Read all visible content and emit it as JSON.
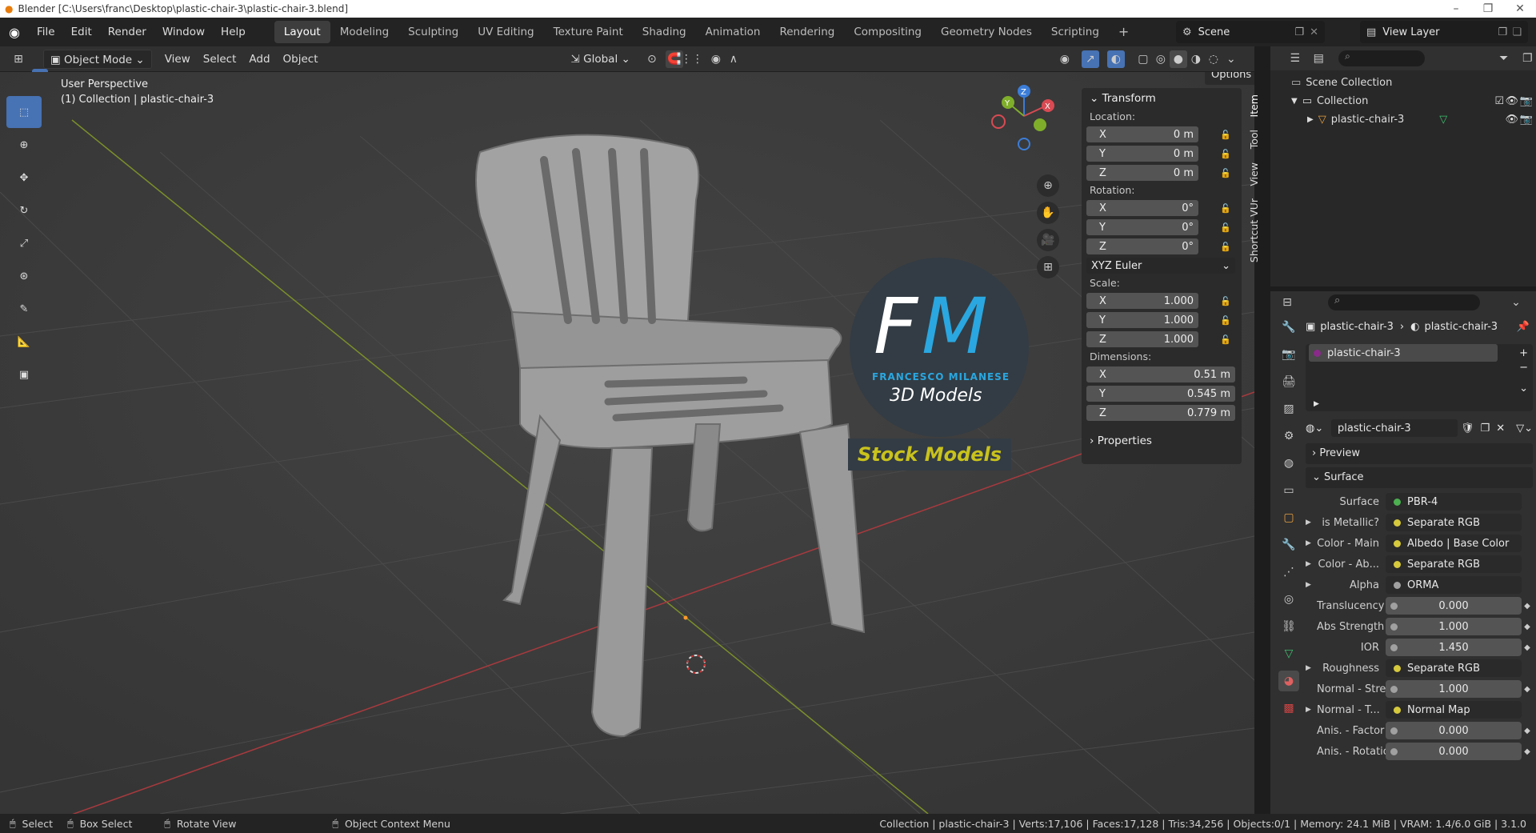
{
  "window": {
    "title": "Blender [C:\\Users\\franc\\Desktop\\plastic-chair-3\\plastic-chair-3.blend]",
    "controls": [
      "–",
      "❐",
      "✕"
    ]
  },
  "menu": {
    "items": [
      "File",
      "Edit",
      "Render",
      "Window",
      "Help"
    ]
  },
  "workspaces": {
    "tabs": [
      "Layout",
      "Modeling",
      "Sculpting",
      "UV Editing",
      "Texture Paint",
      "Shading",
      "Animation",
      "Rendering",
      "Compositing",
      "Geometry Nodes",
      "Scripting"
    ],
    "add": "+"
  },
  "scene": {
    "name": "Scene",
    "view_layer": "View Layer"
  },
  "header": {
    "mode": "Object Mode",
    "view": "View",
    "select": "Select",
    "add": "Add",
    "object": "Object",
    "transform_orientation": "Global",
    "options": "Options"
  },
  "viewport": {
    "perspective": "User Perspective",
    "collection_info": "(1) Collection | plastic-chair-3",
    "gizmo": {
      "x": "X",
      "y": "Y",
      "z": "Z"
    }
  },
  "watermark": {
    "letters_f": "F",
    "letters_m": "M",
    "brand": "FRANCESCO MILANESE",
    "tagline": "3D Models",
    "banner": "Stock Models"
  },
  "npanel": {
    "transform_title": "Transform",
    "location_label": "Location:",
    "location": [
      {
        "axis": "X",
        "value": "0 m"
      },
      {
        "axis": "Y",
        "value": "0 m"
      },
      {
        "axis": "Z",
        "value": "0 m"
      }
    ],
    "rotation_label": "Rotation:",
    "rotation": [
      {
        "axis": "X",
        "value": "0°"
      },
      {
        "axis": "Y",
        "value": "0°"
      },
      {
        "axis": "Z",
        "value": "0°"
      }
    ],
    "rotation_mode": "XYZ Euler",
    "scale_label": "Scale:",
    "scale": [
      {
        "axis": "X",
        "value": "1.000"
      },
      {
        "axis": "Y",
        "value": "1.000"
      },
      {
        "axis": "Z",
        "value": "1.000"
      }
    ],
    "dimensions_label": "Dimensions:",
    "dimensions": [
      {
        "axis": "X",
        "value": "0.51 m"
      },
      {
        "axis": "Y",
        "value": "0.545 m"
      },
      {
        "axis": "Z",
        "value": "0.779 m"
      }
    ],
    "properties_title": "Properties",
    "tabs": [
      "Item",
      "Tool",
      "View",
      "Shortcut VUr"
    ]
  },
  "outliner": {
    "scene_collection": "Scene Collection",
    "collection": "Collection",
    "object": "plastic-chair-3"
  },
  "properties": {
    "breadcrumb_obj": "plastic-chair-3",
    "breadcrumb_mat": "plastic-chair-3",
    "material_slot": "plastic-chair-3",
    "material_name": "plastic-chair-3",
    "preview": "Preview",
    "surface_section": "Surface",
    "rows": [
      {
        "label": "Surface",
        "value": "PBR-4",
        "dot": "#4caf50",
        "kind": "link",
        "expand": false
      },
      {
        "label": "is Metallic?",
        "value": "Separate RGB",
        "dot": "#d6c93c",
        "kind": "link",
        "expand": true
      },
      {
        "label": "Color - Main",
        "value": "Albedo | Base Color",
        "dot": "#d6c93c",
        "kind": "link",
        "expand": true
      },
      {
        "label": "Color - Ab...",
        "value": "Separate RGB",
        "dot": "#d6c93c",
        "kind": "link",
        "expand": true
      },
      {
        "label": "Alpha",
        "value": "ORMA",
        "dot": "#a0a0a0",
        "kind": "link",
        "expand": true
      },
      {
        "label": "Translucency",
        "value": "0.000",
        "dot": "#a0a0a0",
        "kind": "num",
        "expand": false
      },
      {
        "label": "Abs Strength",
        "value": "1.000",
        "dot": "#a0a0a0",
        "kind": "num",
        "expand": false
      },
      {
        "label": "IOR",
        "value": "1.450",
        "dot": "#a0a0a0",
        "kind": "num",
        "expand": false
      },
      {
        "label": "Roughness",
        "value": "Separate RGB",
        "dot": "#d6c93c",
        "kind": "link",
        "expand": true
      },
      {
        "label": "Normal - Stren...",
        "value": "1.000",
        "dot": "#a0a0a0",
        "kind": "num",
        "expand": false
      },
      {
        "label": "Normal - T...",
        "value": "Normal Map",
        "dot": "#d6c93c",
        "kind": "link",
        "expand": true
      },
      {
        "label": "Anis. - Factor",
        "value": "0.000",
        "dot": "#a0a0a0",
        "kind": "num",
        "expand": false
      },
      {
        "label": "Anis. - Rotation",
        "value": "0.000",
        "dot": "#a0a0a0",
        "kind": "num",
        "expand": false
      }
    ]
  },
  "status": {
    "select": "Select",
    "box_select": "Box Select",
    "rotate_view": "Rotate View",
    "context_menu": "Object Context Menu",
    "info": "Collection | plastic-chair-3 | Verts:17,106 | Faces:17,128 | Tris:34,256 | Objects:0/1 | Memory: 24.1 MiB | VRAM: 1.4/6.0 GiB | 3.1.0"
  },
  "colors": {
    "accent": "#4772b3",
    "fm_blue": "#2aa7e0",
    "banner_text": "#c9c21c",
    "x_axis": "#c0393d",
    "y_axis": "#6b9a24"
  }
}
